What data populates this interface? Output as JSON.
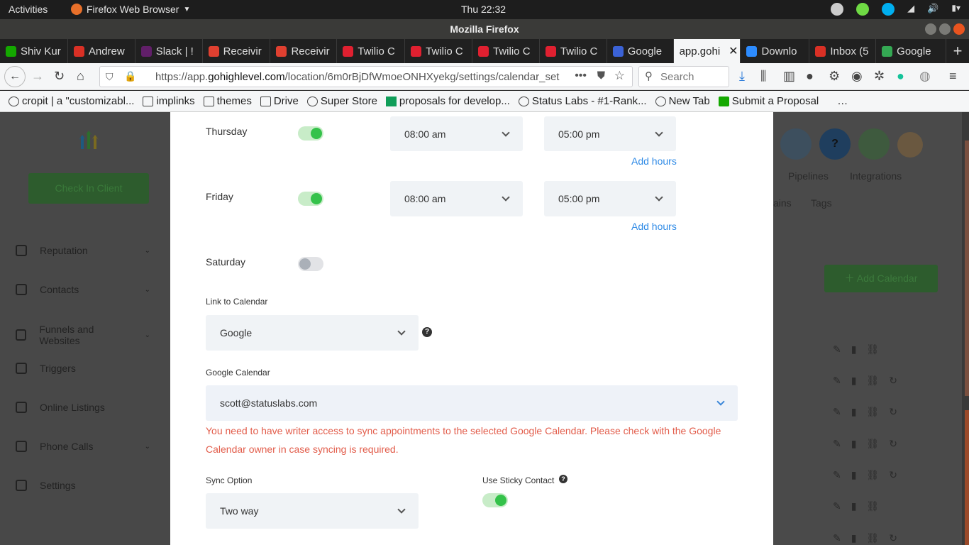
{
  "os": {
    "activities": "Activities",
    "app_name": "Firefox Web Browser",
    "clock": "Thu 22:32"
  },
  "window": {
    "title": "Mozilla Firefox"
  },
  "tabs": [
    {
      "label": "Shiv Kur",
      "color": "#14a800"
    },
    {
      "label": "Andrew",
      "color": "#d93025"
    },
    {
      "label": "Slack | !",
      "color": "#611f69"
    },
    {
      "label": "Receivir",
      "color": "#e04030"
    },
    {
      "label": "Receivir",
      "color": "#e04030"
    },
    {
      "label": "Twilio C",
      "color": "#e02030"
    },
    {
      "label": "Twilio C",
      "color": "#e02030"
    },
    {
      "label": "Twilio C",
      "color": "#e02030"
    },
    {
      "label": "Twilio C",
      "color": "#e02030"
    },
    {
      "label": "Google",
      "color": "#3b62d6"
    },
    {
      "label": "app.gohi",
      "color": "#f5f6f7",
      "active": true
    },
    {
      "label": "Downlo",
      "color": "#2d8cff"
    },
    {
      "label": "Inbox (5",
      "color": "#d93025"
    },
    {
      "label": "Google",
      "color": "#34a853"
    }
  ],
  "nav": {
    "url_prefix": "https://app.",
    "url_domain": "gohighlevel.com",
    "url_path": "/location/6m0rBjDfWmoeONHXyekg/settings/calendar_set",
    "search_placeholder": "Search"
  },
  "bookmarks": [
    {
      "label": "cropit | a \"customizabl...",
      "icon": "globe-icon"
    },
    {
      "label": "implinks",
      "icon": "folder-icon"
    },
    {
      "label": "themes",
      "icon": "folder-icon"
    },
    {
      "label": "Drive",
      "icon": "folder-icon"
    },
    {
      "label": "Super Store",
      "icon": "globe-icon"
    },
    {
      "label": "proposals for develop...",
      "icon": "sheet-icon"
    },
    {
      "label": "Status Labs - #1-Rank...",
      "icon": "globe-icon"
    },
    {
      "label": "New Tab",
      "icon": "globe-icon"
    },
    {
      "label": "Submit a Proposal",
      "icon": "upwork-icon"
    },
    {
      "label": "…",
      "icon": ""
    }
  ],
  "sidebar": {
    "check_in": "Check In Client",
    "items": [
      {
        "label": "Reputation",
        "has_chevron": true
      },
      {
        "label": "Contacts",
        "has_chevron": true
      },
      {
        "label": "Funnels and Websites",
        "has_chevron": true
      },
      {
        "label": "Triggers",
        "has_chevron": false
      },
      {
        "label": "Online Listings",
        "has_chevron": false
      },
      {
        "label": "Phone Calls",
        "has_chevron": true
      },
      {
        "label": "Settings",
        "has_chevron": false
      }
    ]
  },
  "background": {
    "pipelines": "Pipelines",
    "integrations": "Integrations",
    "domains_partial": "ains",
    "tags": "Tags",
    "add_calendar": "Add Calendar"
  },
  "modal": {
    "days": [
      {
        "name": "Thursday",
        "enabled": true,
        "start": "08:00 am",
        "end": "05:00 pm",
        "add_hours": "Add hours"
      },
      {
        "name": "Friday",
        "enabled": true,
        "start": "08:00 am",
        "end": "05:00 pm",
        "add_hours": "Add hours"
      },
      {
        "name": "Saturday",
        "enabled": false
      }
    ],
    "link_to_calendar": {
      "label": "Link to Calendar",
      "value": "Google"
    },
    "google_calendar": {
      "label": "Google Calendar",
      "value": "scott@statuslabs.com"
    },
    "error": "You need to have writer access to sync appointments to the selected Google Calendar. Please check with the Google Calendar owner in case syncing is required.",
    "sync_option": {
      "label": "Sync Option",
      "value": "Two way"
    },
    "sticky_contact": {
      "label": "Use Sticky Contact",
      "enabled": true
    }
  }
}
